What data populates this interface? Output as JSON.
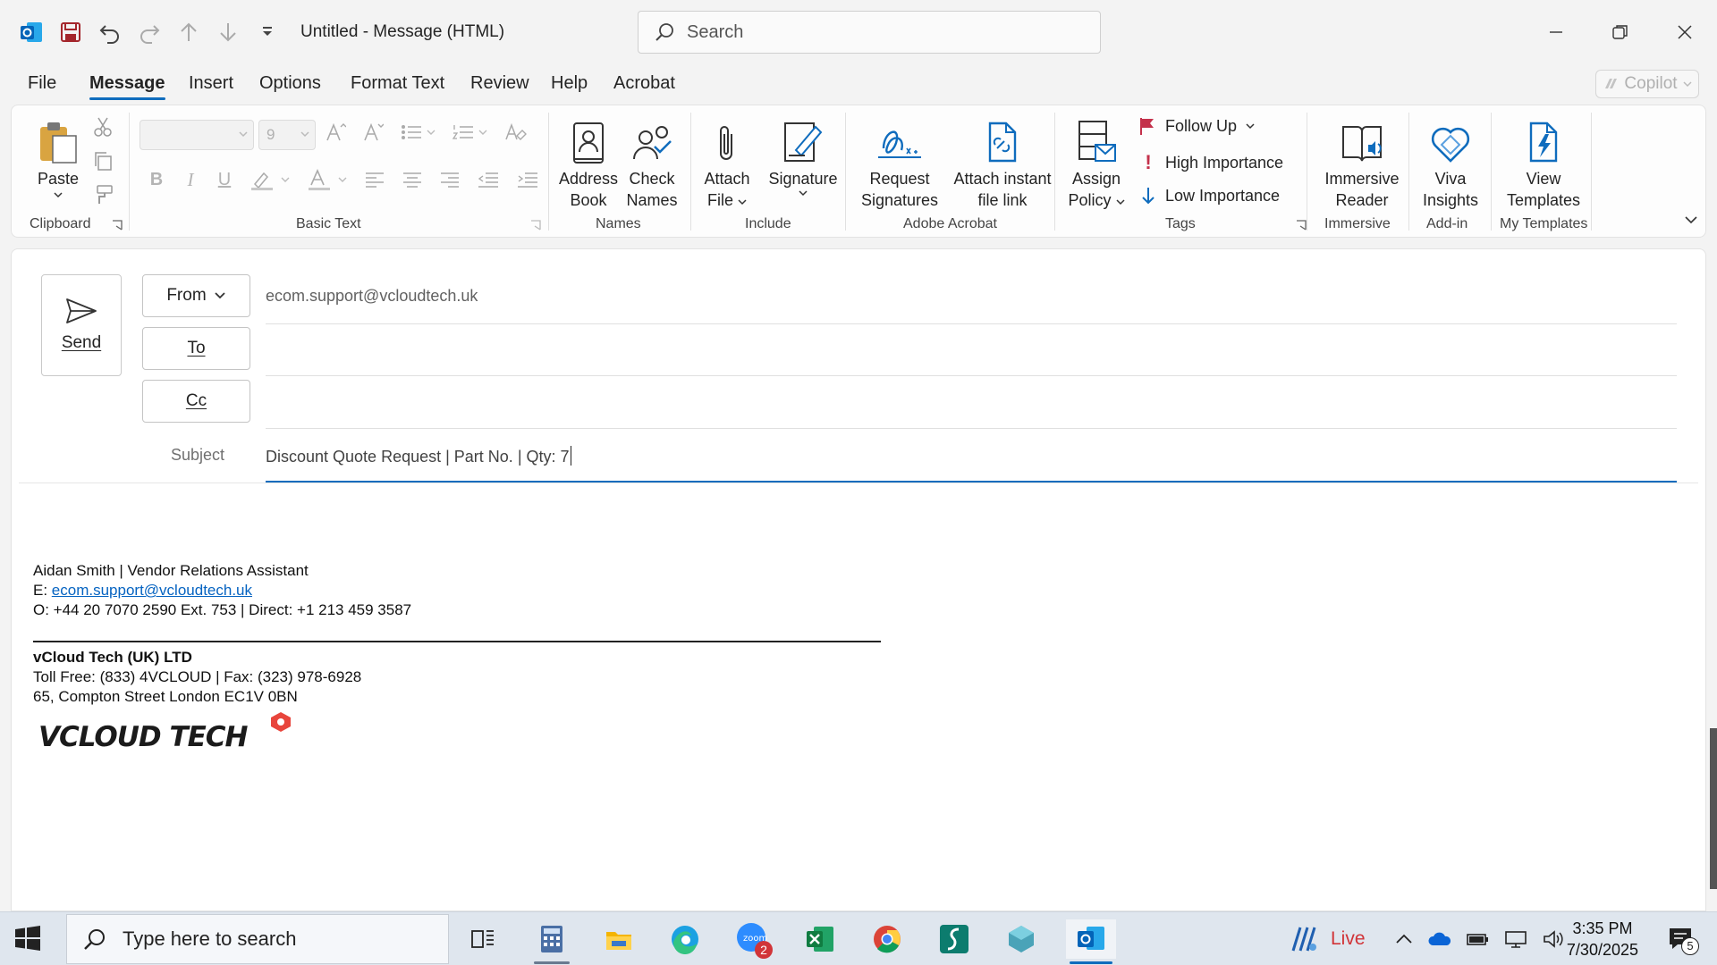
{
  "window": {
    "title": "Untitled  -  Message (HTML)",
    "search_placeholder": "Search"
  },
  "menu": {
    "tabs": [
      "File",
      "Message",
      "Insert",
      "Options",
      "Format Text",
      "Review",
      "Help",
      "Acrobat"
    ],
    "active": "Message",
    "copilot": "Copilot"
  },
  "ribbon": {
    "clipboard": {
      "paste": "Paste",
      "label": "Clipboard"
    },
    "basic_text": {
      "font_size": "9",
      "label": "Basic Text"
    },
    "names": {
      "address_book_1": "Address",
      "address_book_2": "Book",
      "check_names_1": "Check",
      "check_names_2": "Names",
      "label": "Names"
    },
    "include": {
      "attach_1": "Attach",
      "attach_2": "File",
      "signature": "Signature",
      "label": "Include"
    },
    "adobe": {
      "request_1": "Request",
      "request_2": "Signatures",
      "attach_link_1": "Attach instant",
      "attach_link_2": "file link",
      "label": "Adobe Acrobat"
    },
    "tags": {
      "assign_1": "Assign",
      "assign_2": "Policy",
      "follow_up": "Follow Up",
      "high": "High Importance",
      "low": "Low Importance",
      "label": "Tags"
    },
    "immersive": {
      "btn_1": "Immersive",
      "btn_2": "Reader",
      "label": "Immersive"
    },
    "addin": {
      "btn_1": "Viva",
      "btn_2": "Insights",
      "label": "Add-in"
    },
    "templates": {
      "btn_1": "View",
      "btn_2": "Templates",
      "label": "My Templates"
    }
  },
  "compose": {
    "send": "Send",
    "from_label": "From",
    "from_value": "ecom.support@vcloudtech.uk",
    "to_label": "To",
    "cc_label": "Cc",
    "subject_label": "Subject",
    "subject_value": "Discount Quote Request | Part No.  | Qty: 7"
  },
  "signature": {
    "name_line": "Aidan Smith | Vendor Relations Assistant",
    "email_prefix": "E: ",
    "email": "ecom.support@vcloudtech.uk",
    "phone_line": "O:  +44 20 7070 2590 Ext. 753 | Direct: +1 213 459 3587",
    "company": "vCloud Tech (UK) LTD",
    "tollfree_line": "Toll Free: (833) 4VCLOUD | Fax: (323) 978-6928",
    "address_line": "65, Compton Street London EC1V 0BN",
    "logo_text": "VCLOUD TECH"
  },
  "taskbar": {
    "search_placeholder": "Type here to search",
    "live": "Live",
    "time": "3:35 PM",
    "date": "7/30/2025",
    "zoom_badge": "2",
    "notif_badge": "5"
  },
  "colors": {
    "accent": "#0f6cbd",
    "outlook_blue": "#0364b8",
    "follow_flag": "#c4314b"
  }
}
